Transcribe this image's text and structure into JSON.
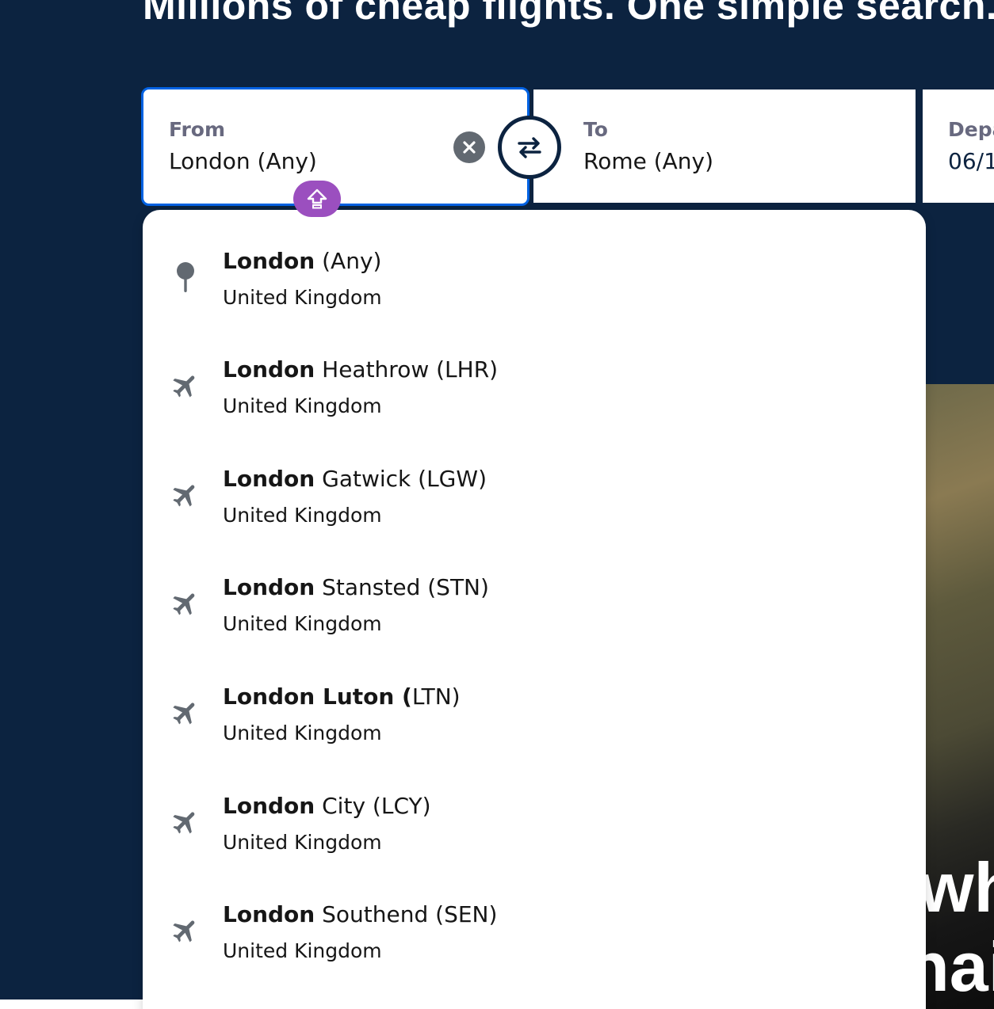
{
  "hero": {
    "headline": "Millions of cheap flights. One simple search."
  },
  "search": {
    "from": {
      "label": "From",
      "value": "London (Any)"
    },
    "to": {
      "label": "To",
      "value": "Rome (Any)"
    },
    "depart": {
      "label": "Depart",
      "value": "06/1"
    },
    "icons": {
      "clear": "close-icon",
      "swap": "swap-arrows-icon",
      "keyboard_badge": "shift-arrow-up-icon"
    }
  },
  "dropdown": {
    "options": [
      {
        "icon": "location-pin-icon",
        "bold": "London",
        "rest": " (Any)",
        "sub": "United Kingdom"
      },
      {
        "icon": "plane-icon",
        "bold": "London",
        "rest": " Heathrow (LHR)",
        "sub": "United Kingdom"
      },
      {
        "icon": "plane-icon",
        "bold": "London",
        "rest": " Gatwick (LGW)",
        "sub": "United Kingdom"
      },
      {
        "icon": "plane-icon",
        "bold": "London",
        "rest": " Stansted (STN)",
        "sub": "United Kingdom"
      },
      {
        "icon": "plane-icon",
        "bold": "London Luton (",
        "rest": "LTN)",
        "sub": "United Kingdom"
      },
      {
        "icon": "plane-icon",
        "bold": "London",
        "rest": " City (LCY)",
        "sub": "United Kingdom"
      },
      {
        "icon": "plane-icon",
        "bold": "London",
        "rest": " Southend (SEN)",
        "sub": "United Kingdom"
      }
    ]
  },
  "promo": {
    "line1": "wh",
    "line2": "hai"
  },
  "colors": {
    "navy": "#0c2340",
    "focus_blue": "#0062e3",
    "icon_grey": "#626971",
    "badge_purple": "#9b4fbf"
  }
}
